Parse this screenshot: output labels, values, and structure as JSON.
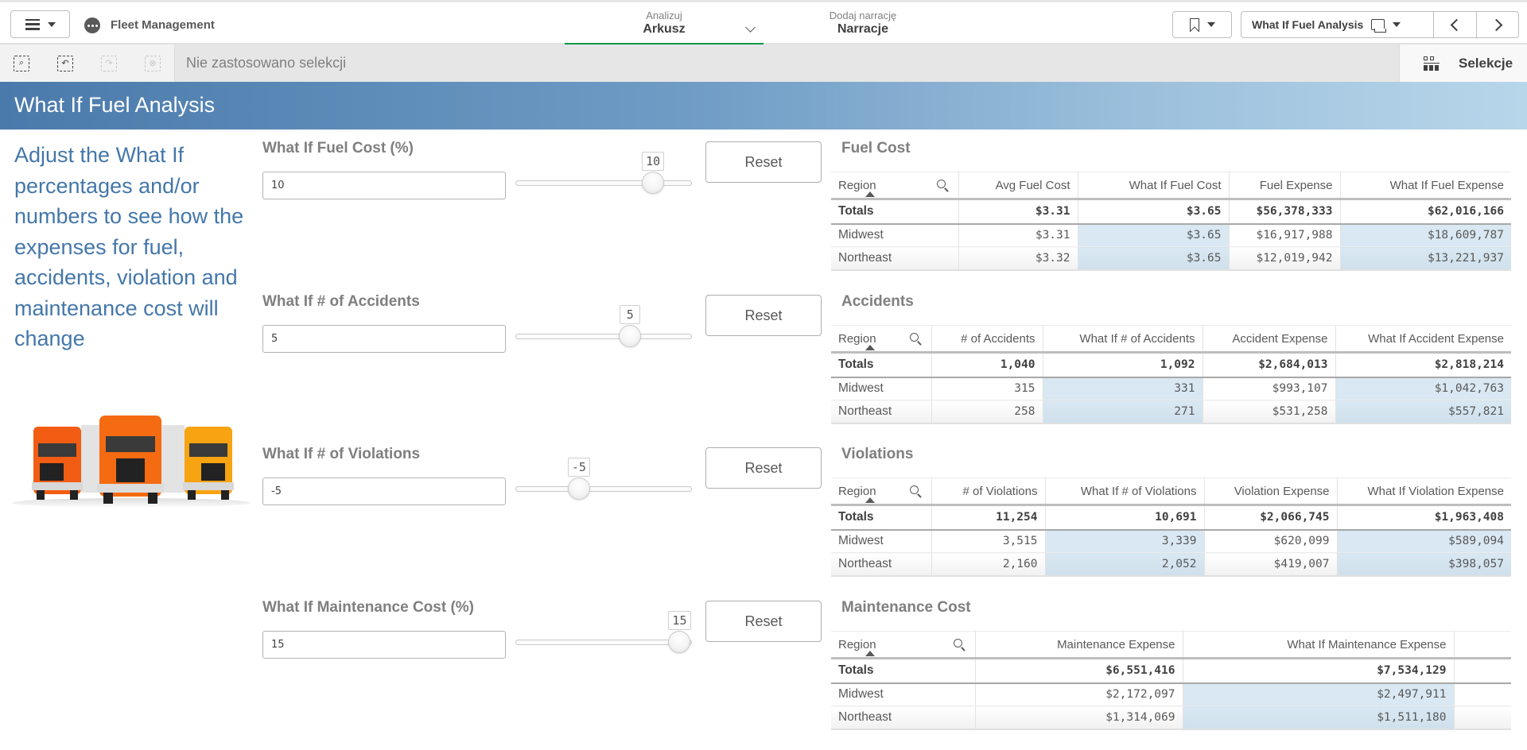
{
  "topbar": {
    "app_name": "Fleet Management",
    "analyze_tab": {
      "small": "Analizuj",
      "label": "Arkusz"
    },
    "story_tab": {
      "small": "Dodaj narrację",
      "label": "Narracje"
    },
    "sheet_selector_label": "What If Fuel Analysis"
  },
  "selection_bar": {
    "status_text": "Nie zastosowano selekcji",
    "selections_label": "Selekcje"
  },
  "sheet": {
    "title": "What If Fuel Analysis",
    "description": "Adjust the What If percentages and/or numbers to see how the expenses for fuel, accidents, violation and maintenance cost will change",
    "image": "trucks-image"
  },
  "controls": [
    {
      "label": "What If Fuel Cost (%)",
      "input_value": "10",
      "slider_value": "10",
      "slider_fraction": 0.78,
      "reset_label": "Reset"
    },
    {
      "label": "What If # of Accidents",
      "input_value": "5",
      "slider_value": "5",
      "slider_fraction": 0.65,
      "reset_label": "Reset"
    },
    {
      "label": "What If # of Violations",
      "input_value": "-5",
      "slider_value": "-5",
      "slider_fraction": 0.36,
      "reset_label": "Reset"
    },
    {
      "label": "What If Maintenance Cost (%)",
      "input_value": "15",
      "slider_value": "15",
      "slider_fraction": 0.93,
      "reset_label": "Reset"
    }
  ],
  "tables": [
    {
      "title": "Fuel Cost",
      "headers": [
        "Region",
        "Avg Fuel Cost",
        "What If Fuel Cost",
        "Fuel Expense",
        "What If Fuel Expense"
      ],
      "totals": [
        "Totals",
        "$3.31",
        "$3.65",
        "$56,378,333",
        "$62,016,166"
      ],
      "rows": [
        [
          "Midwest",
          "$3.31",
          "$3.65",
          "$16,917,988",
          "$18,609,787"
        ],
        [
          "Northeast",
          "$3.32",
          "$3.65",
          "$12,019,942",
          "$13,221,937"
        ]
      ],
      "highlight_cols": [
        2,
        4
      ]
    },
    {
      "title": "Accidents",
      "headers": [
        "Region",
        "# of Accidents",
        "What If # of Accidents",
        "Accident Expense",
        "What If Accident Expense"
      ],
      "totals": [
        "Totals",
        "1,040",
        "1,092",
        "$2,684,013",
        "$2,818,214"
      ],
      "rows": [
        [
          "Midwest",
          "315",
          "331",
          "$993,107",
          "$1,042,763"
        ],
        [
          "Northeast",
          "258",
          "271",
          "$531,258",
          "$557,821"
        ]
      ],
      "highlight_cols": [
        2,
        4
      ]
    },
    {
      "title": "Violations",
      "headers": [
        "Region",
        "# of Violations",
        "What If # of Violations",
        "Violation Expense",
        "What If Violation Expense"
      ],
      "totals": [
        "Totals",
        "11,254",
        "10,691",
        "$2,066,745",
        "$1,963,408"
      ],
      "rows": [
        [
          "Midwest",
          "3,515",
          "3,339",
          "$620,099",
          "$589,094"
        ],
        [
          "Northeast",
          "2,160",
          "2,052",
          "$419,007",
          "$398,057"
        ]
      ],
      "highlight_cols": [
        2,
        4
      ]
    },
    {
      "title": "Maintenance Cost",
      "headers": [
        "Region",
        "Maintenance Expense",
        "What If Maintenance Expense"
      ],
      "totals": [
        "Totals",
        "$6,551,416",
        "$7,534,129"
      ],
      "rows": [
        [
          "Midwest",
          "$2,172,097",
          "$2,497,911"
        ],
        [
          "Northeast",
          "$1,314,069",
          "$1,511,180"
        ]
      ],
      "highlight_cols": [
        2
      ]
    }
  ],
  "colors": {
    "accent_green": "#009845",
    "header_blue_start": "#4a7aab",
    "header_blue_end": "#b8d6ea",
    "description_text": "#4477aa",
    "highlight_cell": "#d9e8f2"
  }
}
